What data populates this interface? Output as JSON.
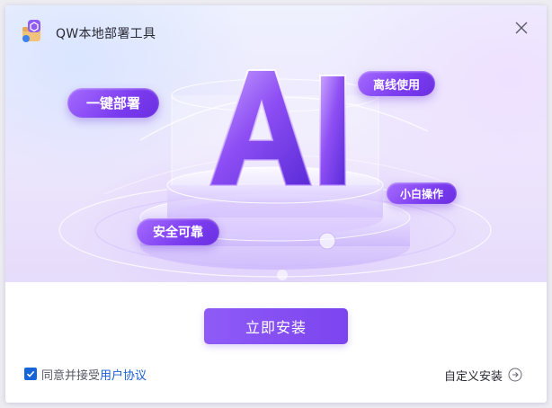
{
  "window": {
    "title": "QW本地部署工具"
  },
  "hero": {
    "headline": "AI",
    "tags": [
      "一键部署",
      "离线使用",
      "小白操作",
      "安全可靠"
    ]
  },
  "actions": {
    "install_label": "立即安装",
    "custom_install_label": "自定义安装"
  },
  "agreement": {
    "checked": true,
    "text": "同意并接受",
    "link": "用户协议"
  },
  "colors": {
    "accent": "#7b44ef",
    "link": "#1a5fd6",
    "checkbox": "#1565d8"
  },
  "icons": {
    "app": "app-logo-icon",
    "close": "close-icon",
    "checkbox": "check-icon",
    "custom_install": "arrow-right-circle-icon"
  }
}
